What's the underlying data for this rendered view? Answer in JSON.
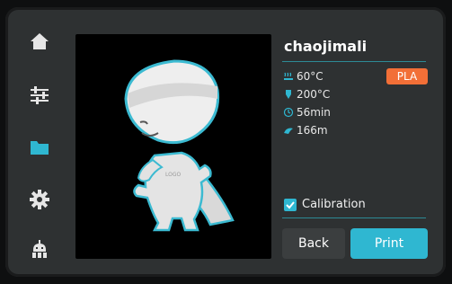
{
  "nav": {
    "items": [
      {
        "icon": "home-icon",
        "active": false
      },
      {
        "icon": "settings-sliders-icon",
        "active": false
      },
      {
        "icon": "folder-icon",
        "active": true
      },
      {
        "icon": "gear-icon",
        "active": false
      },
      {
        "icon": "robot-icon",
        "active": false
      }
    ]
  },
  "file": {
    "name": "chaojimali",
    "material": "PLA",
    "stats": {
      "bed_temp": "60°C",
      "nozzle_temp": "200°C",
      "time": "56min",
      "filament": "166m"
    }
  },
  "options": {
    "calibration_label": "Calibration",
    "calibration_checked": true
  },
  "buttons": {
    "back": "Back",
    "print": "Print"
  },
  "colors": {
    "accent": "#2fb7d1",
    "badge": "#f26f37",
    "panel": "#2e3132",
    "icon": "#e6e6e6",
    "active_icon": "#2fb7d1"
  }
}
